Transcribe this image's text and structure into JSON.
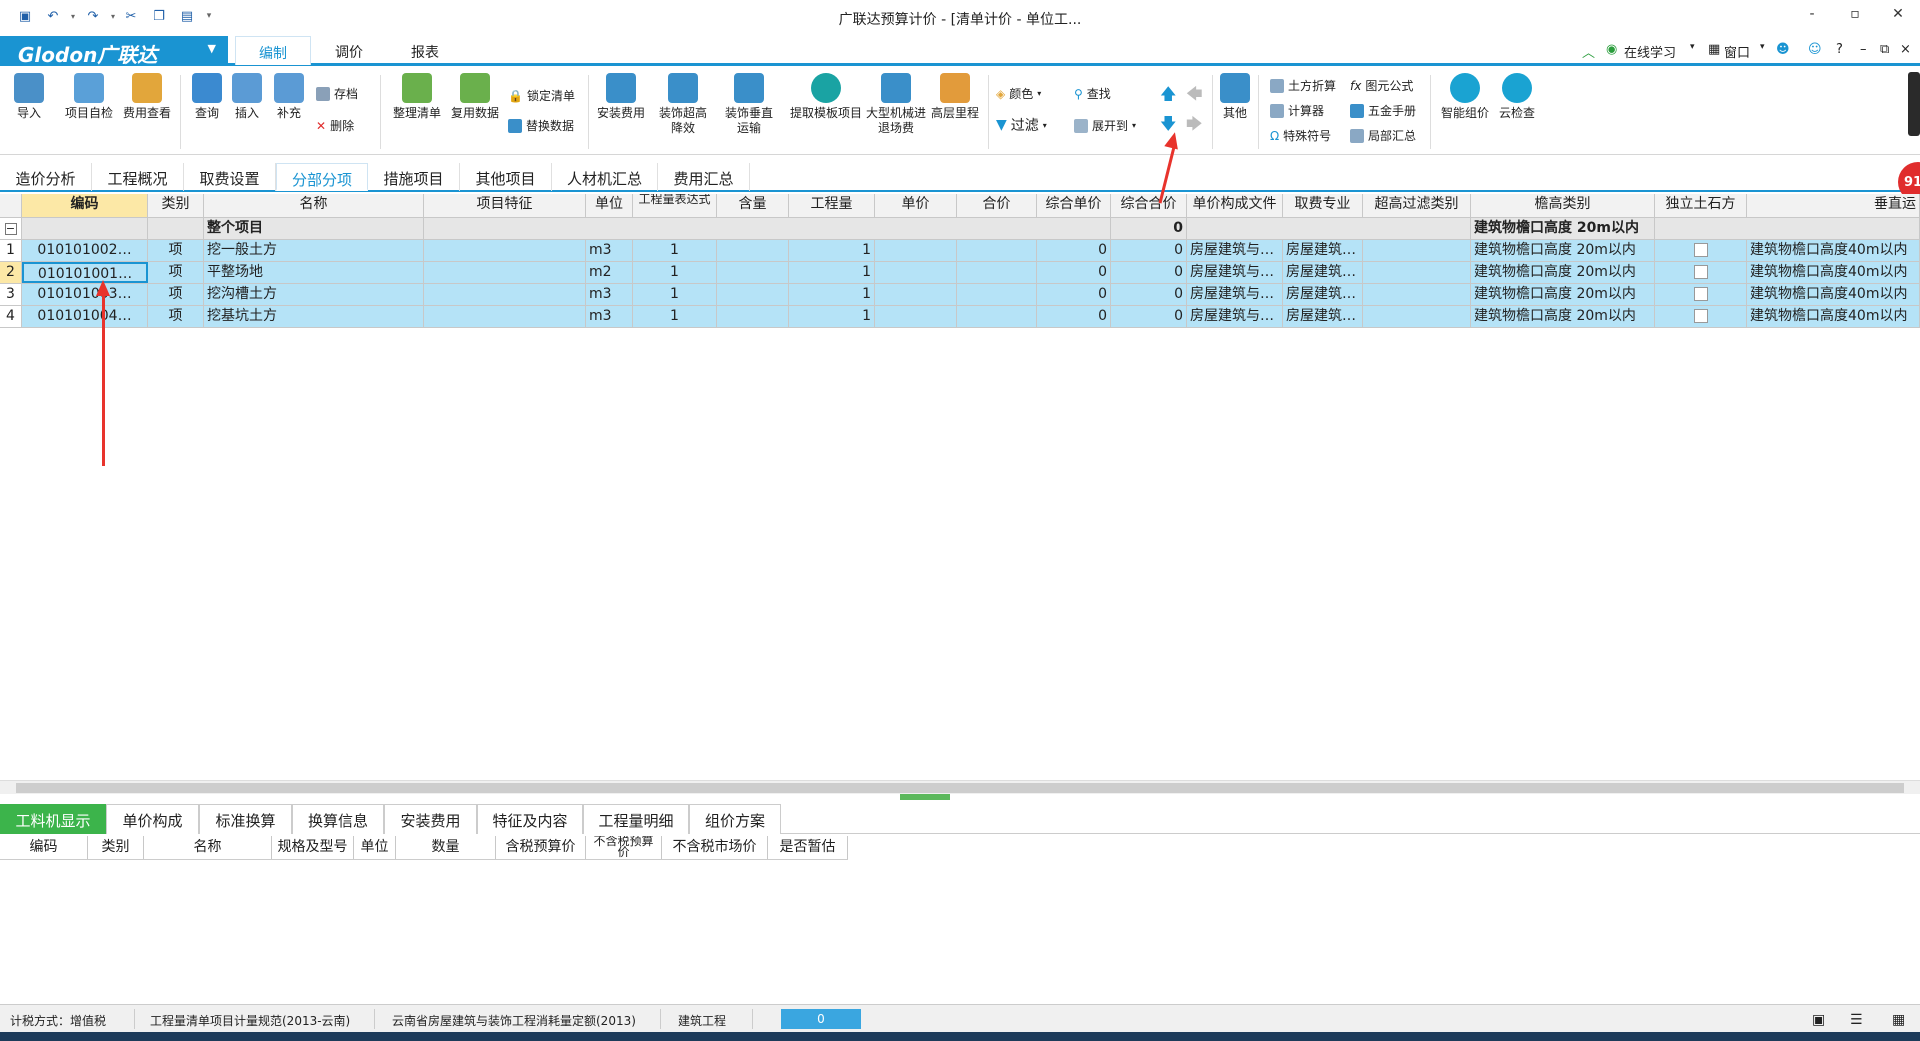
{
  "window": {
    "title": "广联达预算计价 - [清单计价 - 单位工...",
    "controls": [
      "-",
      "▫",
      "✕"
    ]
  },
  "menu": {
    "logo": "Glodon广联达",
    "tabs": [
      "编制",
      "调价",
      "报表"
    ],
    "active": 0,
    "right": [
      "在线学习",
      "窗口",
      "?"
    ]
  },
  "ribbon": {
    "buttons": [
      {
        "label": "导入",
        "icon": "import-icon",
        "color": "#4a90c8"
      },
      {
        "label": "项目自检",
        "icon": "inspect-icon",
        "color": "#5aa0d8"
      },
      {
        "label": "费用查看",
        "icon": "fee-view-icon",
        "color": "#e2a63b"
      },
      {
        "label": "查询",
        "icon": "query-icon",
        "color": "#3b8ad0"
      },
      {
        "label": "插入",
        "icon": "insert-icon",
        "color": "#5b9bd5"
      },
      {
        "label": "补充",
        "icon": "supplement-icon",
        "color": "#5b9bd5"
      },
      {
        "label": "整理清单",
        "icon": "organize-list-icon",
        "color": "#6ab04c"
      },
      {
        "label": "复用数据",
        "icon": "reuse-data-icon",
        "color": "#6ab04c"
      },
      {
        "label": "安装费用",
        "icon": "install-fee-icon",
        "color": "#3a8fc9"
      },
      {
        "label": "装饰超高降效",
        "icon": "decor-height-icon",
        "color": "#3a8fc9"
      },
      {
        "label": "装饰垂直运输",
        "icon": "decor-vertical-icon",
        "color": "#3a8fc9"
      },
      {
        "label": "提取模板项目",
        "icon": "template-icon",
        "color": "#1aa3a3"
      },
      {
        "label": "大型机械进退场费",
        "icon": "machine-icon",
        "color": "#3a8fc9"
      },
      {
        "label": "高层里程",
        "icon": "high-rise-icon",
        "color": "#e29b3b"
      },
      {
        "label": "其他",
        "icon": "grid-icon",
        "color": "#3a8fc9"
      },
      {
        "label": "智能组价",
        "icon": "cloud-price-icon",
        "color": "#1aa3d2"
      },
      {
        "label": "云检查",
        "icon": "cloud-check-icon",
        "color": "#1aa3d2"
      }
    ],
    "small": {
      "save": "存档",
      "delete": "删除",
      "lock": "锁定清单",
      "replace": "替换数据",
      "color": "颜色",
      "find": "查找",
      "filter": "过滤",
      "expand": "展开到",
      "earth": "土方折算",
      "formula": "图元公式",
      "calc": "计算器",
      "hardware": "五金手册",
      "special": "特殊符号",
      "partial": "局部汇总"
    }
  },
  "page_tabs": {
    "items": [
      "造价分析",
      "工程概况",
      "取费设置",
      "分部分项",
      "措施项目",
      "其他项目",
      "人材机汇总",
      "费用汇总"
    ],
    "active": 3
  },
  "badge": "91",
  "table": {
    "columns": [
      "",
      "编码",
      "类别",
      "名称",
      "项目特征",
      "单位",
      "工程量表达式",
      "含量",
      "工程量",
      "单价",
      "合价",
      "综合单价",
      "综合合价",
      "单价构成文件",
      "取费专业",
      "超高过滤类别",
      "檐高类别",
      "独立土石方",
      "垂直运"
    ],
    "group": {
      "marker": "−",
      "name": "整个项目",
      "total": "0",
      "height_class": "建筑物檐口高度 20m以内"
    },
    "rows": [
      {
        "no": "1",
        "code": "010101002…",
        "type": "项",
        "name": "挖一般土方",
        "feature": "",
        "unit": "m3",
        "expr": "1",
        "content": "",
        "qty": "1",
        "price": "",
        "sum": "",
        "unit_price": "0",
        "total": "0",
        "file": "房屋建筑与…",
        "major": "房屋建筑…",
        "filter": "",
        "height": "建筑物檐口高度 20m以内",
        "vertical": "建筑物檐口高度40m以内"
      },
      {
        "no": "2",
        "code": "010101001…",
        "type": "项",
        "name": "平整场地",
        "feature": "",
        "unit": "m2",
        "expr": "1",
        "content": "",
        "qty": "1",
        "price": "",
        "sum": "",
        "unit_price": "0",
        "total": "0",
        "file": "房屋建筑与…",
        "major": "房屋建筑…",
        "filter": "",
        "height": "建筑物檐口高度 20m以内",
        "vertical": "建筑物檐口高度40m以内"
      },
      {
        "no": "3",
        "code": "010101003…",
        "type": "项",
        "name": "挖沟槽土方",
        "feature": "",
        "unit": "m3",
        "expr": "1",
        "content": "",
        "qty": "1",
        "price": "",
        "sum": "",
        "unit_price": "0",
        "total": "0",
        "file": "房屋建筑与…",
        "major": "房屋建筑…",
        "filter": "",
        "height": "建筑物檐口高度 20m以内",
        "vertical": "建筑物檐口高度40m以内"
      },
      {
        "no": "4",
        "code": "010101004…",
        "type": "项",
        "name": "挖基坑土方",
        "feature": "",
        "unit": "m3",
        "expr": "1",
        "content": "",
        "qty": "1",
        "price": "",
        "sum": "",
        "unit_price": "0",
        "total": "0",
        "file": "房屋建筑与…",
        "major": "房屋建筑…",
        "filter": "",
        "height": "建筑物檐口高度 20m以内",
        "vertical": "建筑物檐口高度40m以内"
      }
    ]
  },
  "bottom_tabs": {
    "items": [
      "工料机显示",
      "单价构成",
      "标准换算",
      "换算信息",
      "安装费用",
      "特征及内容",
      "工程量明细",
      "组价方案"
    ],
    "active": 0
  },
  "bottom_columns": [
    "编码",
    "类别",
    "名称",
    "规格及型号",
    "单位",
    "数量",
    "含税预算价",
    "不含税预算价",
    "不含税市场价",
    "是否暂估"
  ],
  "status": {
    "tax": "计税方式：增值税",
    "spec": "工程量清单项目计量规范(2013-云南)",
    "quota": "云南省房屋建筑与装饰工程消耗量定额(2013)",
    "kind": "建筑工程",
    "value": "0"
  }
}
